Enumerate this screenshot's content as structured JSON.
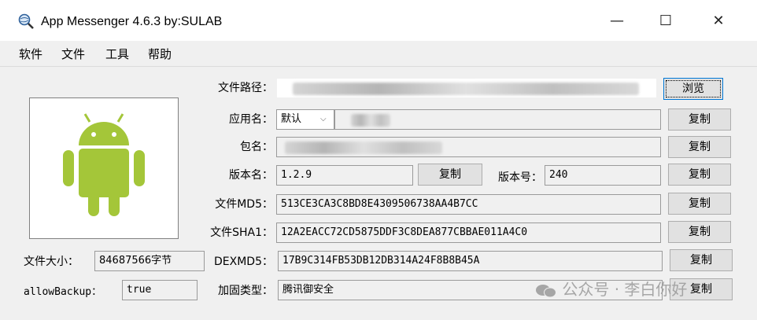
{
  "window": {
    "title": "App Messenger 4.6.3   by:SULAB",
    "controls": {
      "minimize": "—",
      "maximize": "☐",
      "close": "✕"
    }
  },
  "menu": {
    "items": [
      "软件",
      "文件",
      "工具",
      "帮助"
    ]
  },
  "labels": {
    "file_path": "文件路径：",
    "app_name": "应用名：",
    "package_name": "包名：",
    "version_name": "版本名：",
    "version_code": "版本号：",
    "md5": "文件MD5：",
    "sha1": "文件SHA1：",
    "dexmd5": "DEXMD5：",
    "reinforce_type": "加固类型：",
    "file_size": "文件大小：",
    "allow_backup": "allowBackup："
  },
  "values": {
    "language": "默认",
    "version_name": "1.2.9",
    "version_code": "240",
    "md5": "513CE3CA3C8BD8E4309506738AA4B7CC",
    "sha1": "12A2EACC72CD5875DDF3C8DEA877CBBAE011A4C0",
    "dexmd5": "17B9C314FB53DB12DB314A24F8B8B45A",
    "reinforce_type": "腾讯御安全",
    "file_size": "84687566字节",
    "allow_backup": "true"
  },
  "buttons": {
    "browse": "浏览",
    "copy": "复制"
  },
  "watermark": "公众号 · 李白你好",
  "icons": {
    "app": "magnifier-globe-icon",
    "logo": "android-robot-icon",
    "watermark": "wechat-icon"
  },
  "colors": {
    "android_green": "#a4c639",
    "focus_blue": "#0078d7"
  }
}
